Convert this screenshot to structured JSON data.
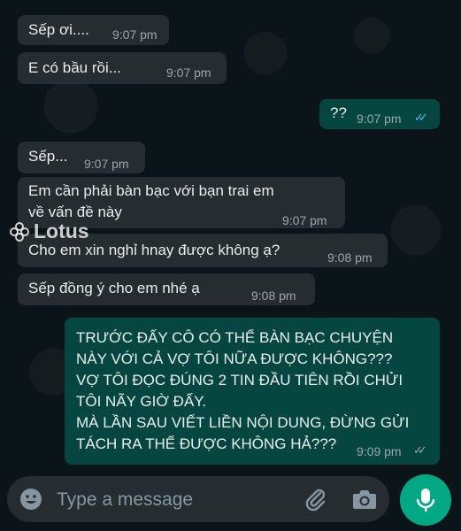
{
  "messages": [
    {
      "text": "Sếp ơi....",
      "time": "9:07 pm"
    },
    {
      "text": "E có bầu rồi...",
      "time": "9:07 pm"
    },
    {
      "text": "??",
      "time": "9:07 pm"
    },
    {
      "text": "Sếp...",
      "time": "9:07 pm"
    },
    {
      "lines": [
        "Em cần phải bàn bạc với bạn trai em",
        "về vấn đề này"
      ],
      "time": "9:07 pm"
    },
    {
      "text": "Cho em xin nghỉ hnay được không ạ?",
      "time": "9:08 pm"
    },
    {
      "text": "Sếp đồng ý cho em nhé ạ",
      "time": "9:08 pm"
    },
    {
      "lines": [
        "TRƯỚC ĐẤY CÔ CÓ THỂ BÀN BẠC CHUYỆN",
        "NÀY VỚI CẢ VỢ TÔI NỮA ĐƯỢC KHÔNG???",
        "VỢ TÔI ĐỌC ĐÚNG 2 TIN ĐẦU TIÊN RỒI CHỬI",
        "TÔI NÃY GIỜ ĐẤY.",
        "MÀ LẦN SAU VIẾT LIỀN NỘI DUNG, ĐỪNG GỬI",
        "TÁCH RA THẾ ĐƯỢC KHÔNG HẢ???"
      ],
      "time": "9:09 pm"
    }
  ],
  "watermark": "Lotus",
  "input": {
    "placeholder": "Type a message"
  },
  "icons": {
    "emoji": "emoji-icon",
    "attach": "paperclip-icon",
    "camera": "camera-icon",
    "mic": "microphone-icon",
    "read_ticks": "double-check-icon"
  },
  "colors": {
    "incoming_bubble": "#262d31",
    "outgoing_bubble": "#054740",
    "read_tick": "#53bdeb",
    "accent": "#00a884"
  }
}
